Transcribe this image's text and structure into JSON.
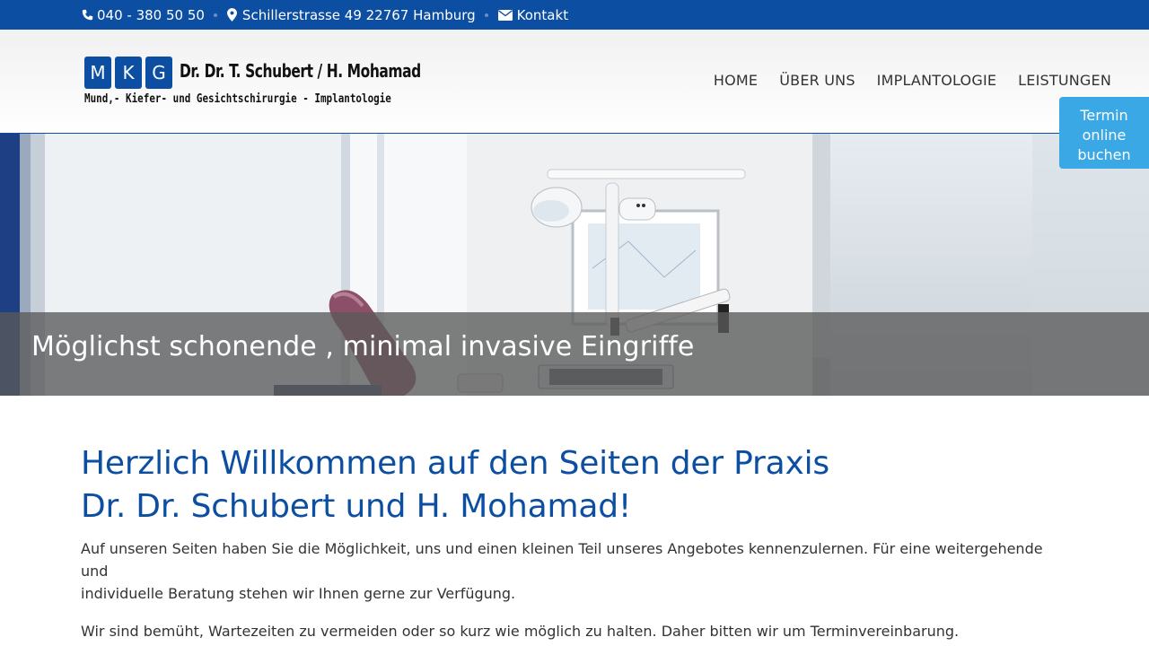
{
  "topbar": {
    "phone": "040 - 380 50 50",
    "address": "Schillerstrasse 49 22767 Hamburg",
    "contact": "Kontakt",
    "icons": [
      "phone-icon",
      "map-marker-icon",
      "envelope-icon"
    ]
  },
  "logo": {
    "letters": [
      "M",
      "K",
      "G"
    ],
    "name": "Dr. Dr. T. Schubert / H. Mohamad",
    "tagline": "Mund,- Kiefer- und Gesichtschirurgie - Implantologie"
  },
  "nav": {
    "items": [
      "HOME",
      "ÜBER UNS",
      "IMPLANTOLOGIE",
      "LEISTUNGEN"
    ]
  },
  "termin": {
    "line1": "Termin online",
    "line2": "buchen"
  },
  "hero": {
    "caption": "Möglichst schonende , minimal invasive Eingriffe"
  },
  "content": {
    "heading_line1": "Herzlich Willkommen auf den Seiten der Praxis",
    "heading_line2": "Dr. Dr. Schubert und H. Mohamad!",
    "paragraph1_line1": "Auf unseren Seiten haben Sie die Möglichkeit, uns und einen kleinen Teil unseres Angebotes kennenzulernen. Für eine weitergehende und",
    "paragraph1_line2": "individuelle Beratung stehen wir Ihnen gerne zur Verfügung.",
    "paragraph2": "Wir sind bemüht, Wartezeiten zu vermeiden oder so kurz wie möglich zu halten. Daher bitten wir um Terminvereinbarung."
  },
  "colors": {
    "brand_blue": "#0b4ea2",
    "termin_blue": "#3aa8e4"
  }
}
